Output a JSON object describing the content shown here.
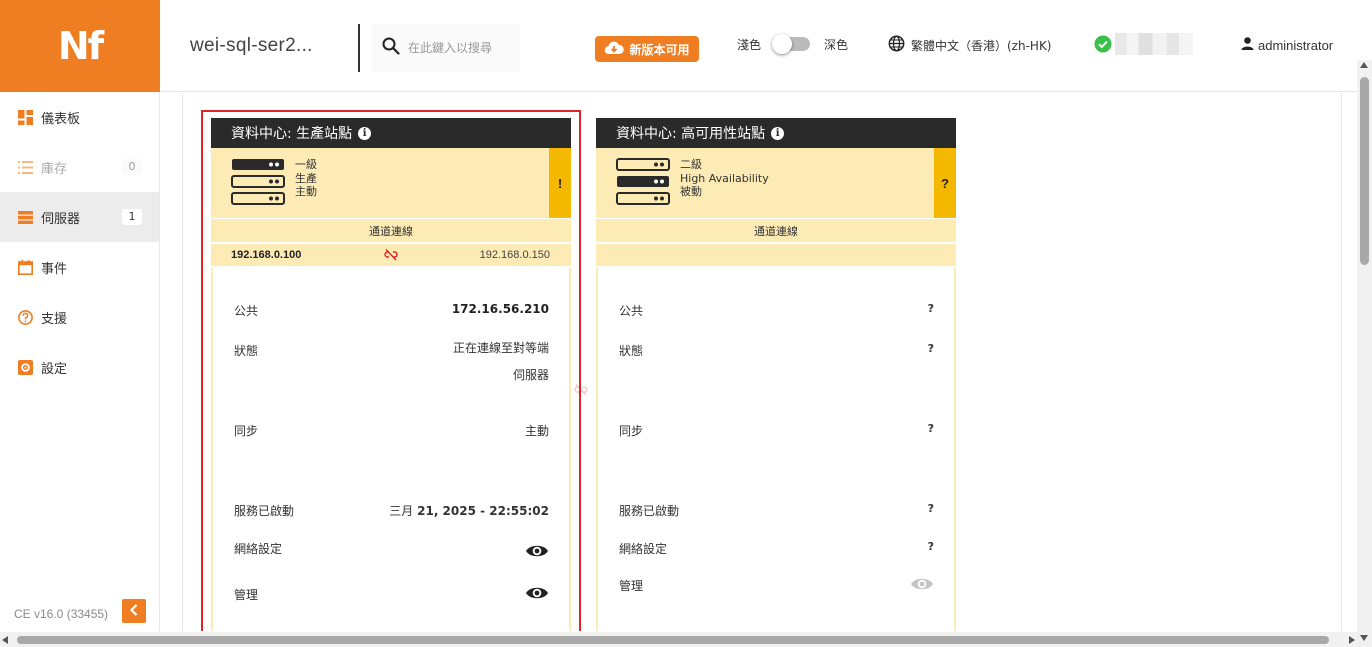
{
  "brand": {
    "logo_text": "Nf",
    "color": "#ef7d22"
  },
  "topbar": {
    "hostname": "wei-sql-ser2...",
    "search_placeholder": "在此鍵入以搜尋",
    "update_label": "新版本可用",
    "theme_light": "淺色",
    "theme_dark": "深色",
    "language": "繁體中文（香港）(zh-HK)",
    "user": "administrator"
  },
  "sidebar": {
    "items": [
      {
        "label": "儀表板",
        "icon": "dashboard-icon"
      },
      {
        "label": "庫存",
        "icon": "list-icon",
        "badge": "0"
      },
      {
        "label": "伺服器",
        "icon": "servers-icon",
        "badge": "1"
      },
      {
        "label": "事件",
        "icon": "calendar-icon"
      },
      {
        "label": "支援",
        "icon": "help-icon"
      },
      {
        "label": "設定",
        "icon": "settings-icon"
      }
    ],
    "version": "CE v16.0 (33455)"
  },
  "cards": [
    {
      "title": "資料中心: 生產站點",
      "status": [
        "一級",
        "生產",
        "主動"
      ],
      "flag": "!",
      "tunnel": "通道連線",
      "ip_local": "192.168.0.100",
      "ip_remote": "192.168.0.150",
      "public_label": "公共",
      "public_value": "172.16.56.210",
      "state_label": "狀態",
      "state_value_1": "正在連線至對等端",
      "state_value_2": "伺服器",
      "sync_label": "同步",
      "sync_value": "主動",
      "service_label": "服務已啟動",
      "service_value_prefix": "三月",
      "service_value": "21, 2025 - 22:55:02",
      "network_label": "網絡設定",
      "manage_label": "管理"
    },
    {
      "title": "資料中心: 高可用性站點",
      "status": [
        "二級",
        "High Availability",
        "被動"
      ],
      "flag": "?",
      "tunnel": "通道連線",
      "public_label": "公共",
      "public_value": "?",
      "state_label": "狀態",
      "state_value": "?",
      "sync_label": "同步",
      "sync_value": "?",
      "service_label": "服務已啟動",
      "service_value": "?",
      "network_label": "網絡設定",
      "network_value": "?",
      "manage_label": "管理"
    }
  ]
}
